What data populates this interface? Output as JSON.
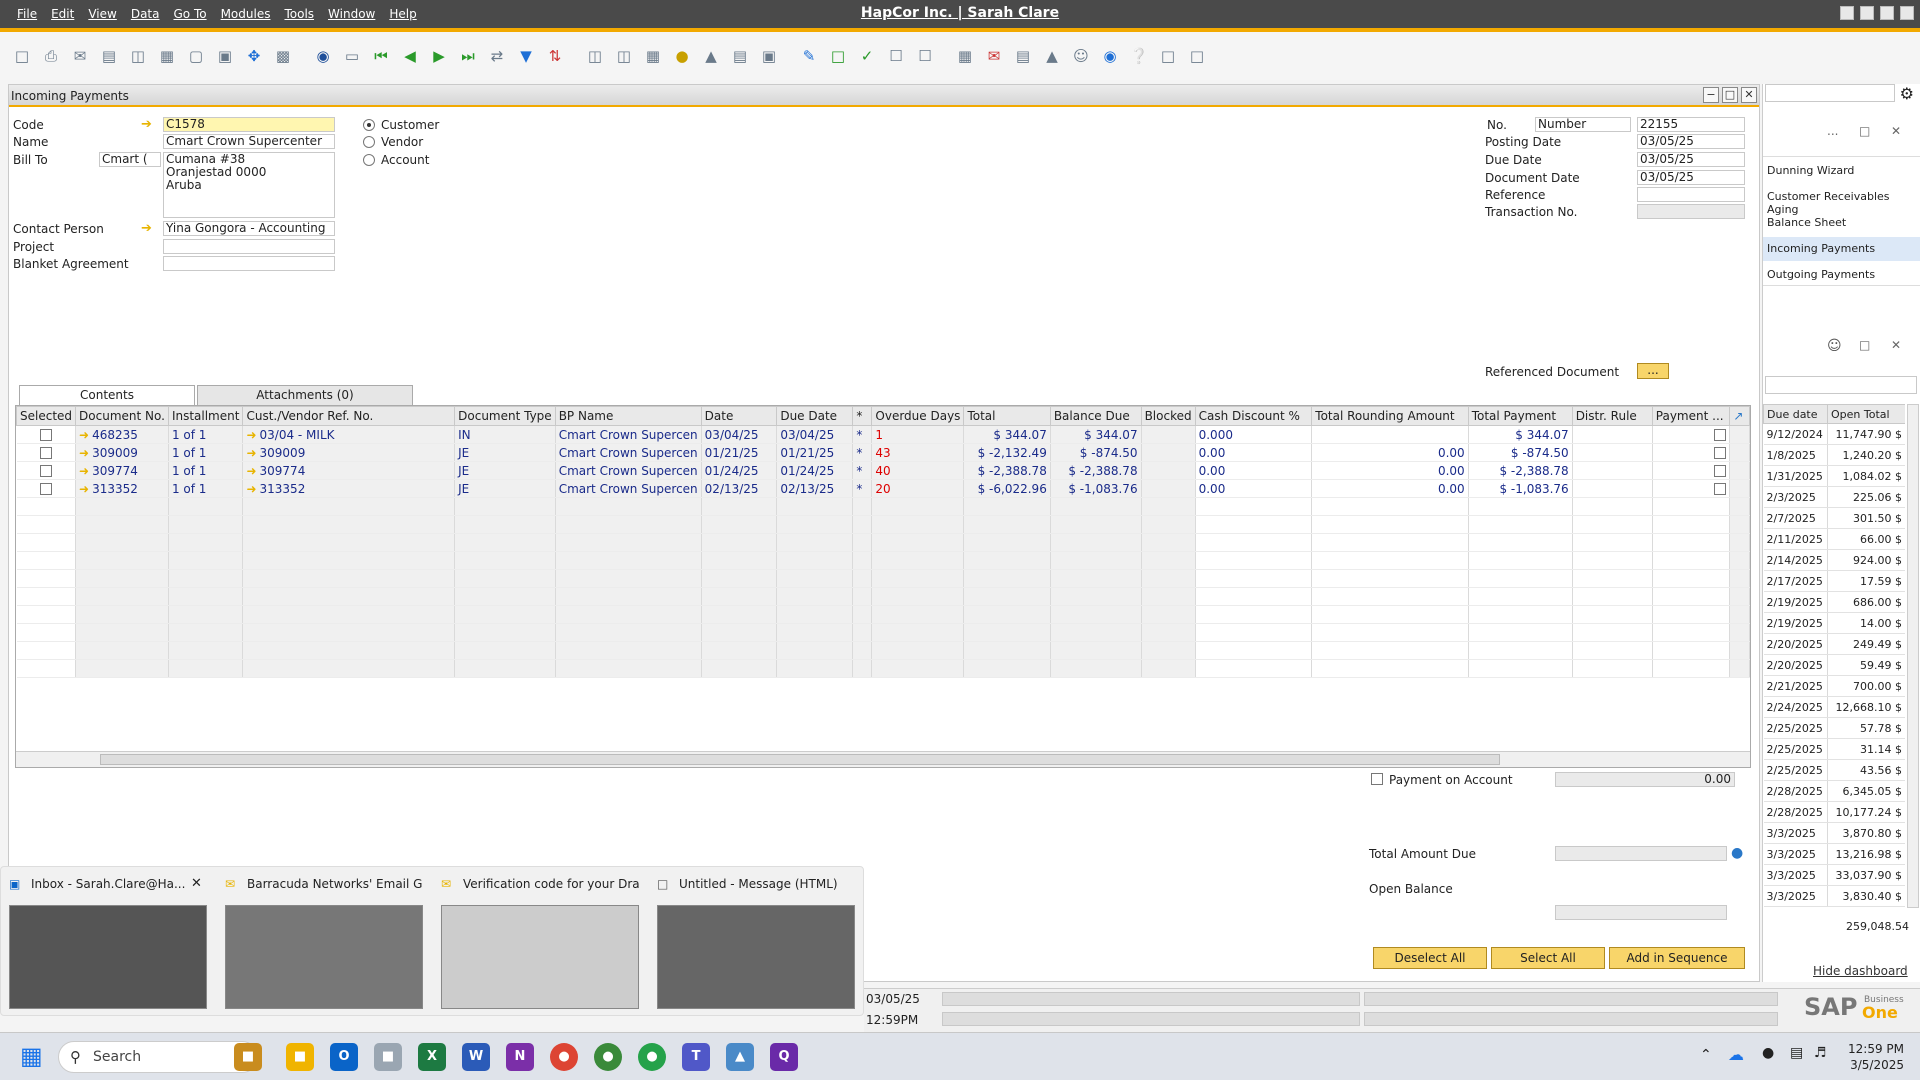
{
  "menu": [
    "File",
    "Edit",
    "View",
    "Data",
    "Go To",
    "Modules",
    "Tools",
    "Window",
    "Help"
  ],
  "app_title": "HapCor Inc. | Sarah Clare",
  "form": {
    "title": "Incoming Payments",
    "labels": {
      "code": "Code",
      "name": "Name",
      "bill_to": "Bill To",
      "contact": "Contact Person",
      "project": "Project",
      "blanket": "Blanket Agreement"
    },
    "code": "C1578",
    "name": "Cmart Crown Supercenter",
    "bill_to_sel": "Cmart (",
    "address": [
      "Cumana #38",
      "Oranjestad  0000",
      "Aruba"
    ],
    "contact": "Yina Gongora - Accounting",
    "radios": [
      "Customer",
      "Vendor",
      "Account"
    ],
    "right_labels": {
      "no": "No.",
      "posting": "Posting Date",
      "due": "Due Date",
      "docdate": "Document Date",
      "reference": "Reference",
      "trans": "Transaction No."
    },
    "no_series": "Number",
    "no": "22155",
    "posting": "03/05/25",
    "due": "03/05/25",
    "docdate": "03/05/25",
    "ref_doc_label": "Referenced Document",
    "ref_doc_btn": "...",
    "tabs": [
      "Contents",
      "Attachments (0)"
    ],
    "columns": [
      "Selected",
      "Document No.",
      "Installment",
      "Cust./Vendor Ref. No.",
      "Document Type",
      "BP Name",
      "Date",
      "Due Date",
      "*",
      "Overdue Days",
      "Total",
      "Balance Due",
      "Blocked",
      "Cash Discount %",
      "Total Rounding Amount",
      "Total Payment",
      "Distr. Rule",
      "Payment ..."
    ],
    "rows": [
      {
        "doc": "468235",
        "inst": "1 of 1",
        "ref": "03/04 - MILK",
        "type": "IN",
        "bp": "Cmart Crown Supercen",
        "date": "03/04/25",
        "due": "03/04/25",
        "star": "*",
        "over": "1",
        "total": "$ 344.07",
        "bal": "$ 344.07",
        "disc": "0.000",
        "round": "",
        "pay": "$ 344.07"
      },
      {
        "doc": "309009",
        "inst": "1 of 1",
        "ref": "309009",
        "type": "JE",
        "bp": "Cmart Crown Supercen",
        "date": "01/21/25",
        "due": "01/21/25",
        "star": "*",
        "over": "43",
        "total": "$ -2,132.49",
        "bal": "$ -874.50",
        "disc": "0.00",
        "round": "0.00",
        "pay": "$ -874.50"
      },
      {
        "doc": "309774",
        "inst": "1 of 1",
        "ref": "309774",
        "type": "JE",
        "bp": "Cmart Crown Supercen",
        "date": "01/24/25",
        "due": "01/24/25",
        "star": "*",
        "over": "40",
        "total": "$ -2,388.78",
        "bal": "$ -2,388.78",
        "disc": "0.00",
        "round": "0.00",
        "pay": "$ -2,388.78"
      },
      {
        "doc": "313352",
        "inst": "1 of 1",
        "ref": "313352",
        "type": "JE",
        "bp": "Cmart Crown Supercen",
        "date": "02/13/25",
        "due": "02/13/25",
        "star": "*",
        "over": "20",
        "total": "$ -6,022.96",
        "bal": "$ -1,083.76",
        "disc": "0.00",
        "round": "0.00",
        "pay": "$ -1,083.76"
      }
    ],
    "payment_on_account": "Payment on Account",
    "poa_value": "0.00",
    "total_due_label": "Total Amount Due",
    "open_balance_label": "Open Balance",
    "buttons": {
      "deselect": "Deselect All",
      "select": "Select All",
      "sequence": "Add in Sequence"
    }
  },
  "dashboard": {
    "links": [
      "Dunning Wizard",
      "Customer Receivables Aging",
      "Balance Sheet",
      "Incoming Payments",
      "Outgoing Payments"
    ],
    "col_due": "Due date",
    "col_open": "Open Total",
    "rows": [
      [
        "9/12/2024",
        "11,747.90 $"
      ],
      [
        "1/8/2025",
        "1,240.20 $"
      ],
      [
        "1/31/2025",
        "1,084.02 $"
      ],
      [
        "2/3/2025",
        "225.06 $"
      ],
      [
        "2/7/2025",
        "301.50 $"
      ],
      [
        "2/11/2025",
        "66.00 $"
      ],
      [
        "2/14/2025",
        "924.00 $"
      ],
      [
        "2/17/2025",
        "17.59 $"
      ],
      [
        "2/19/2025",
        "686.00 $"
      ],
      [
        "2/19/2025",
        "14.00 $"
      ],
      [
        "2/20/2025",
        "249.49 $"
      ],
      [
        "2/20/2025",
        "59.49 $"
      ],
      [
        "2/21/2025",
        "700.00 $"
      ],
      [
        "2/24/2025",
        "12,668.10 $"
      ],
      [
        "2/25/2025",
        "57.78 $"
      ],
      [
        "2/25/2025",
        "31.14 $"
      ],
      [
        "2/25/2025",
        "43.56 $"
      ],
      [
        "2/28/2025",
        "6,345.05 $"
      ],
      [
        "2/28/2025",
        "10,177.24 $"
      ],
      [
        "3/3/2025",
        "3,870.80 $"
      ],
      [
        "3/3/2025",
        "13,216.98 $"
      ],
      [
        "3/3/2025",
        "33,037.90 $"
      ],
      [
        "3/3/2025",
        "3,830.40 $"
      ]
    ],
    "sum": "259,048.54",
    "hide": "Hide dashboard",
    "logo": "SAP",
    "logo_sub1": "Business",
    "logo_sub2": "One"
  },
  "status": {
    "date": "03/05/25",
    "time": "12:59PM"
  },
  "thumbs": [
    "Inbox - Sarah.Clare@Ha...",
    "Barracuda Networks' Email Gat...",
    "Verification code for your Draft...",
    "Untitled - Message (HTML)"
  ],
  "taskbar": {
    "search": "Search",
    "time": "12:59 PM",
    "date": "3/5/2025"
  }
}
